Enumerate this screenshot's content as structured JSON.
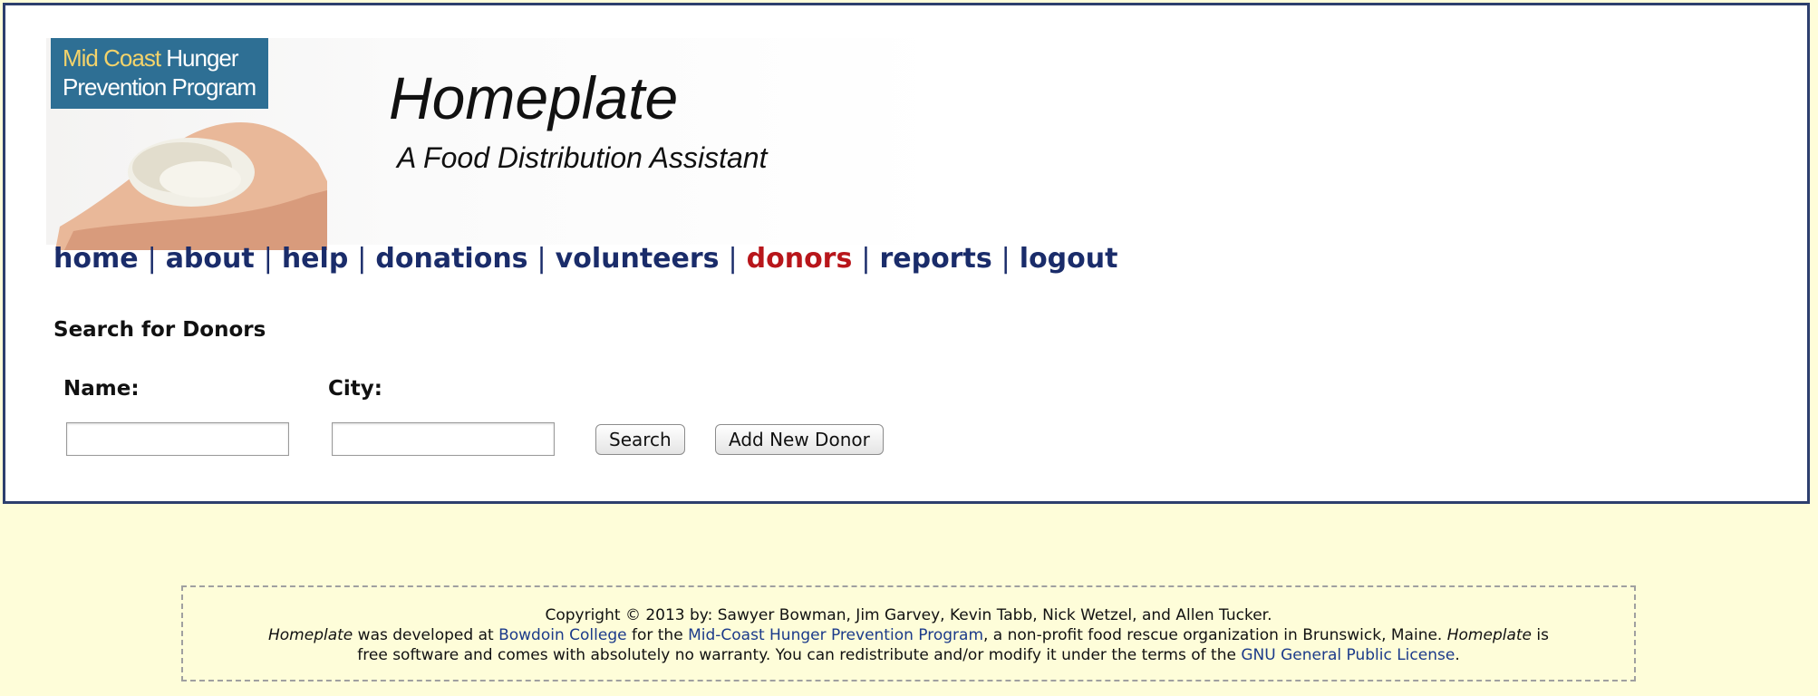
{
  "header": {
    "logo_line1_highlight": "Mid Coast",
    "logo_line1_rest": " Hunger",
    "logo_line2": "Prevention Program",
    "title": "Homeplate",
    "subtitle": "A Food Distribution Assistant"
  },
  "nav": {
    "items": [
      {
        "label": "home"
      },
      {
        "label": "about"
      },
      {
        "label": "help"
      },
      {
        "label": "donations"
      },
      {
        "label": "volunteers"
      },
      {
        "label": "donors",
        "active": true
      },
      {
        "label": "reports"
      },
      {
        "label": "logout"
      }
    ],
    "separator": "|",
    "active_color": "#b8161b",
    "link_color": "#1a2c6a"
  },
  "search": {
    "title": "Search for Donors",
    "name_label": "Name:",
    "city_label": "City:",
    "name_value": "",
    "city_value": "",
    "search_button": "Search",
    "add_button": "Add New Donor"
  },
  "footer": {
    "copyright": "Copyright © 2013 by: Sawyer Bowman, Jim Garvey, Kevin Tabb, Nick Wetzel, and Allen Tucker.",
    "app_name": "Homeplate",
    "text_a": " was developed at ",
    "link_college": "Bowdoin College",
    "text_b": " for the ",
    "link_program": "Mid-Coast Hunger Prevention Program",
    "text_c": ", a non-profit food rescue organization in Brunswick, Maine. ",
    "text_d": " is",
    "line3_a": "free software and comes with absolutely no warranty. You can redistribute and/or modify it under the terms of the ",
    "link_license": "GNU General Public License",
    "line3_end": "."
  },
  "colors": {
    "page_background": "#fefdd9",
    "frame_border": "#2d3f6e",
    "logo_background": "#2e6f94",
    "logo_highlight": "#f3d36b"
  }
}
